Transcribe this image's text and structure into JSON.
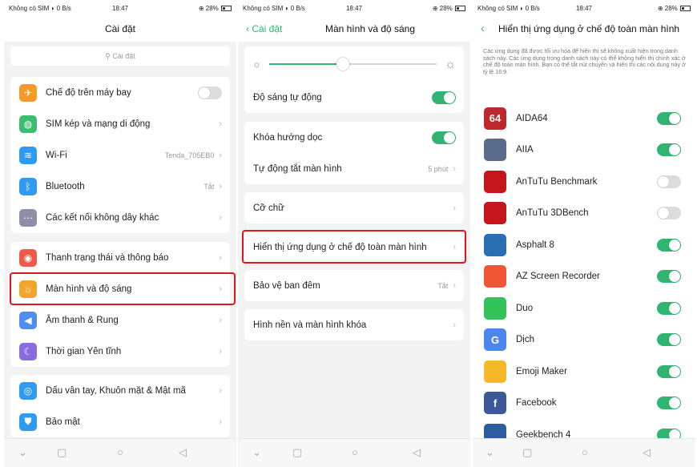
{
  "status": {
    "carrier": "Không có SIM",
    "data_rate": "0 B/s",
    "time": "18:47",
    "battery": "28%"
  },
  "screen1": {
    "title": "Cài đặt",
    "search_placeholder": "Cài đặt",
    "airplane": "Chế độ trên máy bay",
    "sim": "SIM kép và mạng di động",
    "wifi": "Wi-Fi",
    "wifi_value": "Tenda_705EB0",
    "bluetooth": "Bluetooth",
    "bluetooth_value": "Tắt",
    "other_connections": "Các kết nối không dây khác",
    "notification_bar": "Thanh trạng thái và thông báo",
    "display": "Màn hình và độ sáng",
    "sound": "Âm thanh & Rung",
    "quiet_time": "Thời gian Yên tĩnh",
    "fingerprint": "Dấu vân tay, Khuôn mặt & Mật mã",
    "security": "Bảo mật"
  },
  "screen2": {
    "back_label": "Cài đặt",
    "title": "Màn hình và độ sáng",
    "brightness_level": 0.44,
    "auto_brightness": "Độ sáng tự động",
    "portrait_lock": "Khóa hướng dọc",
    "auto_sleep": "Tự động tắt màn hình",
    "auto_sleep_value": "5 phút",
    "font_size": "Cỡ chữ",
    "fullscreen_apps": "Hiển thị ứng dụng ở chế độ toàn màn hình",
    "night_shield": "Bảo vệ ban đêm",
    "night_shield_value": "Tắt",
    "wallpaper": "Hình nền và màn hình khóa"
  },
  "screen3": {
    "title": "Hiển thị ứng dụng ở chế độ toàn màn hình",
    "description": "Các ứng dụng đã được tối ưu hóa để hiển thị sẽ không xuất hiện trong danh sách này. Các ứng dụng trong danh sách này có thể không hiển thị chính xác ở chế độ toàn màn hình. Bạn có thể tắt nút chuyển và hiển thị các nội dung này ở tỷ lệ 16:9.",
    "apps": [
      {
        "name": "AIDA64",
        "icon": "aida64-icon",
        "icon_text": "64",
        "color": "#c0272d",
        "on": true
      },
      {
        "name": "AIIA",
        "icon": "aiia-icon",
        "icon_text": "",
        "color": "#5a6b8c",
        "on": true
      },
      {
        "name": "AnTuTu Benchmark",
        "icon": "antutu-icon",
        "icon_text": "",
        "color": "#c4161c",
        "on": false
      },
      {
        "name": "AnTuTu 3DBench",
        "icon": "antutu-3d-icon",
        "icon_text": "",
        "color": "#c4161c",
        "on": false
      },
      {
        "name": "Asphalt 8",
        "icon": "asphalt-icon",
        "icon_text": "",
        "color": "#2a6fb3",
        "on": true
      },
      {
        "name": "AZ Screen Recorder",
        "icon": "az-recorder-icon",
        "icon_text": "",
        "color": "#f05537",
        "on": true
      },
      {
        "name": "Duo",
        "icon": "duo-icon",
        "icon_text": "",
        "color": "#33c35a",
        "on": true
      },
      {
        "name": "Dịch",
        "icon": "translate-icon",
        "icon_text": "G",
        "color": "#4a85f0",
        "on": true
      },
      {
        "name": "Emoji Maker",
        "icon": "emoji-icon",
        "icon_text": "",
        "color": "#f7b92a",
        "on": true
      },
      {
        "name": "Facebook",
        "icon": "facebook-icon",
        "icon_text": "f",
        "color": "#3b5998",
        "on": true
      },
      {
        "name": "Geekbench 4",
        "icon": "geekbench-icon",
        "icon_text": "",
        "color": "#2c5d9e",
        "on": true
      }
    ]
  },
  "colors": {
    "accent": "#2fb571",
    "highlight": "#e0161d"
  }
}
